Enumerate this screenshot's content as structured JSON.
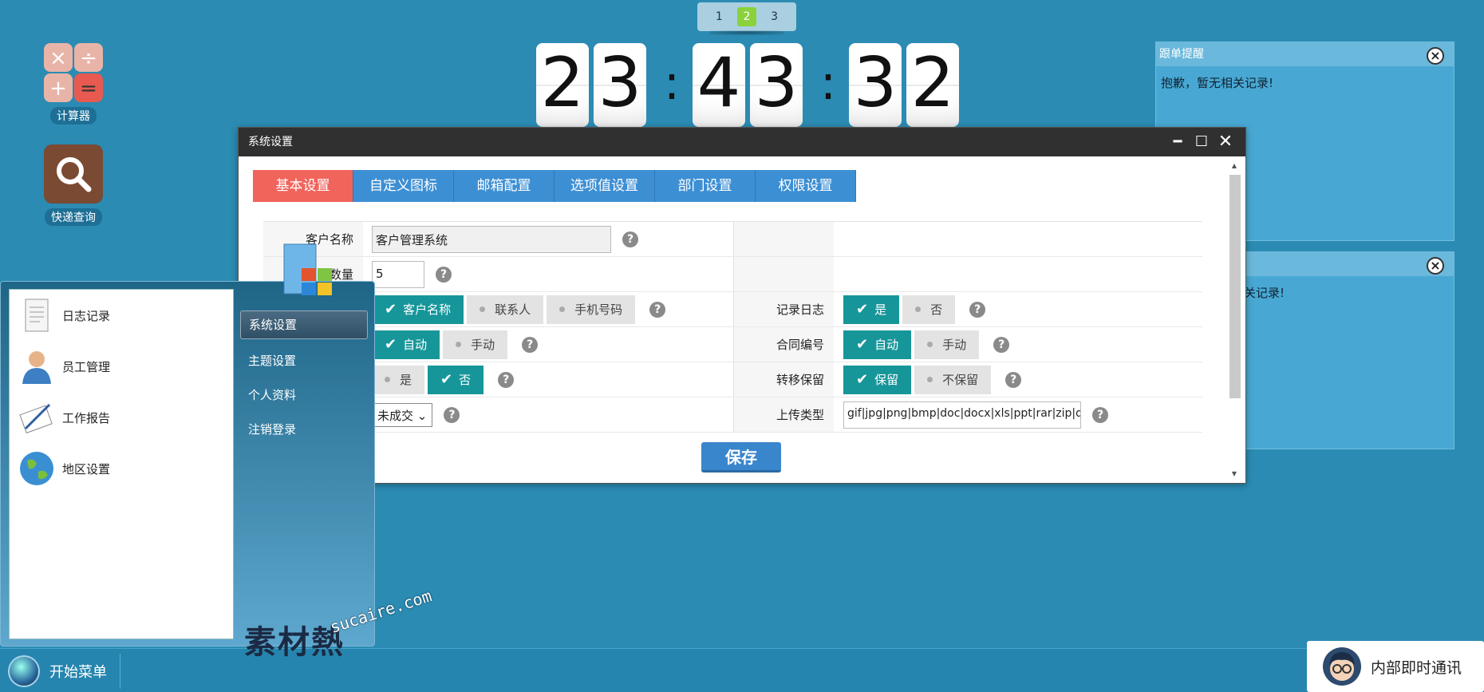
{
  "pager": {
    "pages": [
      "1",
      "2",
      "3"
    ],
    "active_index": 1
  },
  "clock": {
    "digits": [
      "2",
      "3",
      "4",
      "3",
      "3",
      "2"
    ],
    "separator": ":"
  },
  "desktop": {
    "calculator_label": "计算器",
    "search_label": "快递查询"
  },
  "reminder": {
    "title": "跟单提醒",
    "message": "抱歉，暂无相关记录!",
    "second_message_fragment": "关记录!"
  },
  "settings_window": {
    "title": "系统设置",
    "tabs": [
      "基本设置",
      "自定义图标",
      "邮箱配置",
      "选项值设置",
      "部门设置",
      "权限设置"
    ],
    "active_tab": "基本设置",
    "rows": [
      {
        "label": "客户名称",
        "value": "客户管理系统"
      },
      {
        "label": "数量",
        "value": "5"
      },
      {
        "options": [
          "客户名称",
          "联系人",
          "手机号码"
        ],
        "right_label": "记录日志",
        "right_options": [
          "是",
          "否"
        ]
      },
      {
        "options": [
          "自动",
          "手动"
        ],
        "right_label": "合同编号",
        "right_options": [
          "自动",
          "手动"
        ]
      },
      {
        "options": [
          "是",
          "否"
        ],
        "right_label": "转移保留",
        "right_options": [
          "保留",
          "不保留"
        ]
      },
      {
        "select_value": "未成交",
        "right_label": "上传类型",
        "right_value": "gif|jpg|png|bmp|doc|docx|xls|ppt|rar|zip|d"
      }
    ],
    "save_label": "保存",
    "help_glyph": "?"
  },
  "start_menu": {
    "left_items": [
      "日志记录",
      "员工管理",
      "工作报告",
      "地区设置"
    ],
    "right_items": [
      "系统设置",
      "主题设置",
      "个人资料",
      "注销登录"
    ],
    "active_right": "系统设置"
  },
  "taskbar": {
    "start_label": "开始菜单"
  },
  "im": {
    "label": "内部即时通讯"
  },
  "watermark": {
    "main": "素材熱",
    "sub": "sucaire.com"
  },
  "colors": {
    "desktop": "#2b8bb3",
    "tab_active": "#f0645c",
    "tab": "#3d8fd4",
    "option_on": "#17969a",
    "save": "#3a86cd"
  }
}
